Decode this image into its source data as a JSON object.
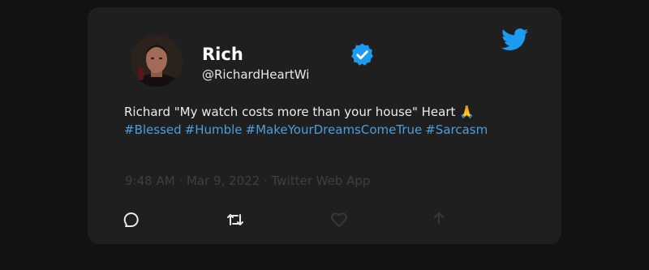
{
  "tweet": {
    "display_name": "Rich",
    "handle": "@RichardHeartWi",
    "text": "Richard \"My watch costs more than your house\" Heart 🙏",
    "hashtags": [
      "#Blessed",
      "#Humble",
      "#MakeYourDreamsComeTrue",
      "#Sarcasm"
    ],
    "meta": "9:48 AM · Mar 9, 2022 · Twitter Web App"
  },
  "icons": {
    "verified": "verified-badge-icon",
    "brand": "twitter-bird-icon",
    "reply": "reply-icon",
    "retweet": "retweet-icon",
    "like": "like-icon",
    "share": "share-icon"
  },
  "colors": {
    "background": "#121212",
    "card": "#1f1f1f",
    "accent": "#1d9bf0",
    "hashtag": "#4a9fe0",
    "meta": "#3f3f3f"
  }
}
